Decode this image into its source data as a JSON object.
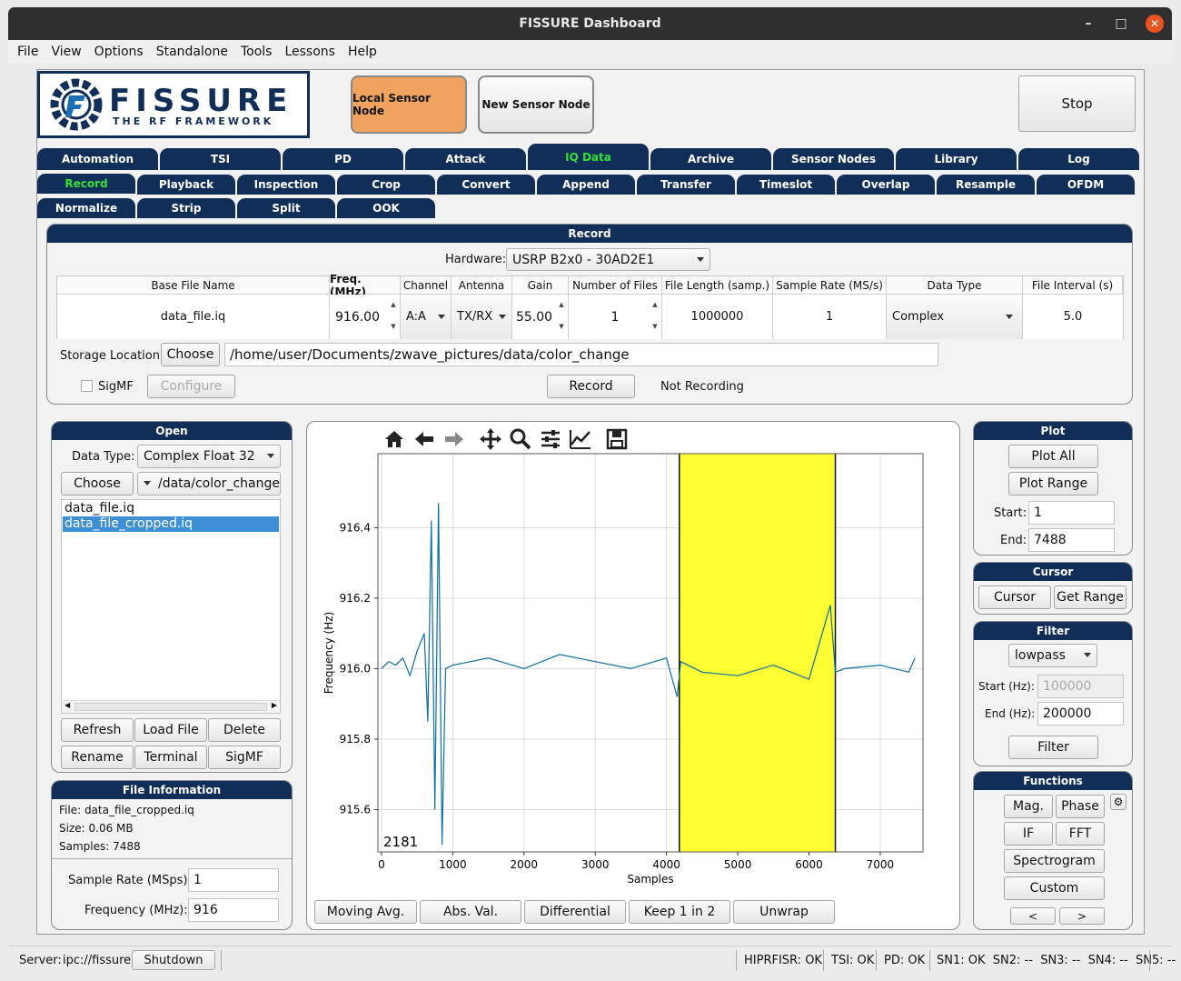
{
  "window": {
    "title": "FISSURE Dashboard",
    "minimize": "–",
    "maximize": "□",
    "close": "✕"
  },
  "menu": [
    "File",
    "View",
    "Options",
    "Standalone",
    "Tools",
    "Lessons",
    "Help"
  ],
  "logo": {
    "name": "FISSURE",
    "tagline": "THE RF FRAMEWORK"
  },
  "header": {
    "local_sensor": "Local Sensor Node",
    "new_sensor": "New Sensor Node",
    "stop": "Stop",
    "local_color": "#f0a35e"
  },
  "main_tabs": [
    "Automation",
    "TSI",
    "PD",
    "Attack",
    "IQ Data",
    "Archive",
    "Sensor Nodes",
    "Library",
    "Log"
  ],
  "sub_tabs_row1": [
    "Record",
    "Playback",
    "Inspection",
    "Crop",
    "Convert",
    "Append",
    "Transfer",
    "Timeslot",
    "Overlap",
    "Resample",
    "OFDM"
  ],
  "sub_tabs_row2": [
    "Normalize",
    "Strip",
    "Split",
    "OOK"
  ],
  "record": {
    "title": "Record",
    "hardware_label": "Hardware:",
    "hardware_value": "USRP B2x0 - 30AD2E1",
    "columns": [
      "Base File Name",
      "Freq. (MHz)",
      "Channel",
      "Antenna",
      "Gain",
      "Number of Files",
      "File Length (samp.)",
      "Sample Rate (MS/s)",
      "Data Type",
      "File Interval (s)"
    ],
    "row": {
      "base_file_name": "data_file.iq",
      "freq": "916.00",
      "channel": "A:A",
      "antenna": "TX/RX",
      "gain": "55.00",
      "num_files": "1",
      "file_length": "1000000",
      "sample_rate": "1",
      "data_type": "Complex",
      "file_interval": "5.0"
    },
    "storage_label": "Storage Location:",
    "choose": "Choose",
    "storage_path": "/home/user/Documents/zwave_pictures/data/color_change",
    "sigmf": "SigMF",
    "configure": "Configure",
    "record_button": "Record",
    "status": "Not Recording"
  },
  "open": {
    "title": "Open",
    "data_type_label": "Data Type:",
    "data_type": "Complex Float 32",
    "choose": "Choose",
    "folder": "/data/color_change",
    "files": [
      "data_file.iq",
      "data_file_cropped.iq"
    ],
    "selected": 1,
    "buttons": [
      "Refresh",
      "Load File",
      "Delete",
      "Rename",
      "Terminal",
      "SigMF"
    ]
  },
  "file_info": {
    "title": "File Information",
    "file": "File: data_file_cropped.iq",
    "size": "Size: 0.06 MB",
    "samples": "Samples: 7488",
    "sample_rate_label": "Sample Rate (MSps):",
    "sample_rate": "1",
    "frequency_label": "Frequency (MHz):",
    "frequency": "916"
  },
  "plot_tools": [
    "home-icon",
    "back-arrow-icon",
    "forward-arrow-icon",
    "pan-icon",
    "zoom-icon",
    "configure-subplots-icon",
    "edit-axis-icon",
    "save-icon"
  ],
  "chart_data": {
    "type": "line",
    "xlabel": "Samples",
    "ylabel": "Frequency (Hz)",
    "xlim": [
      -50,
      7600
    ],
    "ylim": [
      915.48,
      916.61
    ],
    "xticks": [
      0,
      1000,
      2000,
      3000,
      4000,
      5000,
      6000,
      7000
    ],
    "yticks": [
      915.6,
      915.8,
      916.0,
      916.2,
      916.4
    ],
    "ytick_labels": [
      "915.6",
      "915.8",
      "916.0",
      "916.2",
      "916.4"
    ],
    "highlight": {
      "start": 4180,
      "end": 6370,
      "color": "#ffff33"
    },
    "line_color": "#0b6fa4",
    "corner_value": "2181",
    "series": [
      {
        "x": [
          0,
          100,
          200,
          300,
          400,
          500,
          600,
          650,
          700,
          750,
          800,
          850,
          900,
          1000,
          1500,
          2000,
          2500,
          3000,
          3500,
          4000,
          4150,
          4200,
          4500,
          5000,
          5500,
          6000,
          6300,
          6370,
          6500,
          7000,
          7400,
          7488
        ],
        "y": [
          916.0,
          916.02,
          916.01,
          916.03,
          915.98,
          916.05,
          916.1,
          915.85,
          916.42,
          915.6,
          916.47,
          915.5,
          916.0,
          916.01,
          916.03,
          916.0,
          916.04,
          916.02,
          916.0,
          916.03,
          915.92,
          916.02,
          915.99,
          915.98,
          916.01,
          915.97,
          916.18,
          915.99,
          916.0,
          916.01,
          915.99,
          916.03
        ]
      }
    ]
  },
  "plot_buttons": [
    "Moving Avg.",
    "Abs. Val.",
    "Differential",
    "Keep 1 in 2",
    "Unwrap"
  ],
  "plot_panel": {
    "title": "Plot",
    "plot_all": "Plot All",
    "plot_range": "Plot Range",
    "start_label": "Start:",
    "start": "1",
    "end_label": "End:",
    "end": "7488"
  },
  "cursor_panel": {
    "title": "Cursor",
    "cursor": "Cursor",
    "get_range": "Get Range"
  },
  "filter_panel": {
    "title": "Filter",
    "type": "lowpass",
    "start_label": "Start (Hz):",
    "start": "100000",
    "end_label": "End (Hz):",
    "end": "200000",
    "filter": "Filter"
  },
  "functions_panel": {
    "title": "Functions",
    "mag": "Mag.",
    "phase": "Phase",
    "if": "IF",
    "fft": "FFT",
    "spectrogram": "Spectrogram",
    "custom": "Custom",
    "prev": "<",
    "next": ">"
  },
  "status_bar": {
    "server_label": "Server:",
    "server": "ipc://fissure",
    "shutdown": "Shutdown",
    "hiprfisr": "HIPRFISR: OK",
    "tsi": "TSI: OK",
    "pd": "PD: OK",
    "sensor_nodes": "SN1: OK  SN2: --  SN3: --  SN4: --  SN5: --"
  }
}
